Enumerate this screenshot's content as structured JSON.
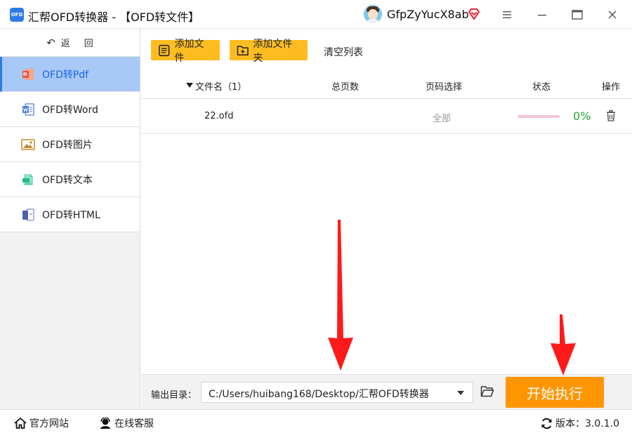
{
  "window": {
    "logo_text": "OFD",
    "title": "汇帮OFD转换器 - 【OFD转文件】",
    "username": "GfpZyYucX8ab"
  },
  "sidebar": {
    "back_label": "返回",
    "items": [
      {
        "label": "OFD转Pdf",
        "icon": "pdf-icon",
        "active": true
      },
      {
        "label": "OFD转Word",
        "icon": "word-icon",
        "active": false
      },
      {
        "label": "OFD转图片",
        "icon": "image-icon",
        "active": false
      },
      {
        "label": "OFD转文本",
        "icon": "text-icon",
        "active": false
      },
      {
        "label": "OFD转HTML",
        "icon": "html-icon",
        "active": false
      }
    ]
  },
  "toolbar": {
    "add_file": "添加文件",
    "add_folder": "添加文件夹",
    "clear_list": "清空列表"
  },
  "table": {
    "headers": {
      "name": "文件名（1）",
      "pages": "总页数",
      "range": "页码选择",
      "status": "状态",
      "ops": "操作"
    },
    "rows": [
      {
        "file": "22.ofd",
        "pages": "",
        "range": "全部",
        "progress": 0,
        "percent": "0%"
      }
    ]
  },
  "output": {
    "label": "输出目录：",
    "path": "C:/Users/huibang168/Desktop/汇帮OFD转换器",
    "start_label": "开始执行"
  },
  "statusbar": {
    "site": "官方网站",
    "service": "在线客服",
    "version": "版本：3.0.1.0"
  },
  "colors": {
    "accent": "#2f7be6",
    "toolbar_button": "#fdbd21",
    "start_button": "#ff9500",
    "progress_text": "#2aa43b",
    "active_nav_bg": "#a8c8f8",
    "annotation_arrow": "#ff1a1a"
  }
}
